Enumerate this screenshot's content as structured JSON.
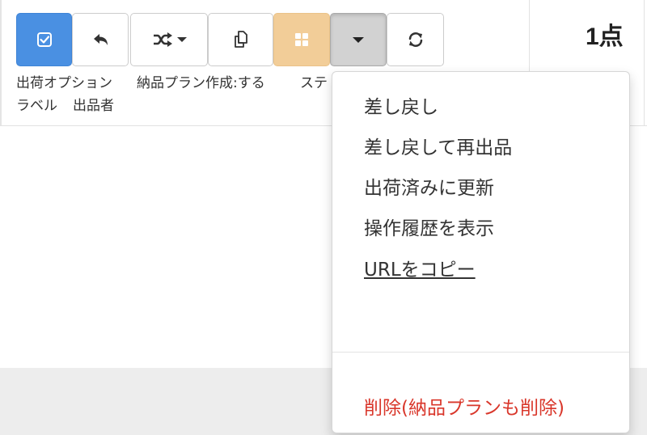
{
  "toolbar": {
    "buttons": [
      {
        "icon": "check-square-icon"
      },
      {
        "icon": "undo-icon"
      },
      {
        "icon": "shuffle-icon"
      },
      {
        "icon": "copy-icon"
      },
      {
        "icon": "grid-icon"
      },
      {
        "icon": "caret-down-icon"
      },
      {
        "icon": "refresh-icon"
      }
    ],
    "count": "1点"
  },
  "labels": {
    "shipping_option": "出荷オプション",
    "plan_creation": "納品プラン作成:する",
    "status": "ステ",
    "label": "ラベル",
    "seller": "出品者"
  },
  "dropdown": {
    "items": [
      {
        "label": "差し戻し"
      },
      {
        "label": "差し戻して再出品"
      },
      {
        "label": "出荷済みに更新"
      },
      {
        "label": "操作履歴を表示"
      },
      {
        "label": "URLをコピー"
      }
    ],
    "danger_item": {
      "label": "削除(納品プランも削除)"
    }
  },
  "colors": {
    "primary_button": "#4a90e2",
    "warning_button": "#f2cd98",
    "active_button": "#d2d2d2",
    "danger_text": "#d9372b"
  }
}
